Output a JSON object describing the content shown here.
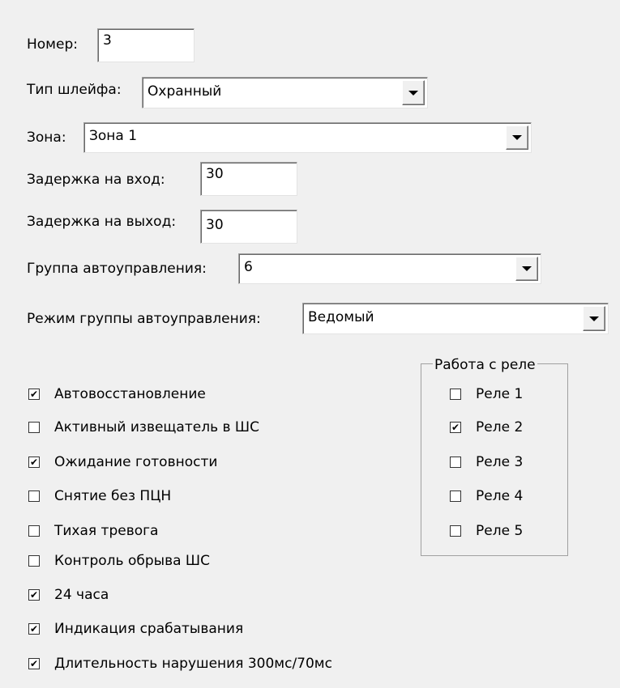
{
  "fields": {
    "number": {
      "label": "Номер:",
      "value": "3"
    },
    "loop_type": {
      "label": "Тип шлейфа:",
      "value": "Охранный"
    },
    "zone": {
      "label": "Зона:",
      "value": "Зона 1"
    },
    "entry_delay": {
      "label": "Задержка на вход:",
      "value": "30"
    },
    "exit_delay": {
      "label": "Задержка на выход:",
      "value": "30"
    },
    "auto_group": {
      "label": "Группа автоуправления:",
      "value": "6"
    },
    "auto_group_mode": {
      "label": "Режим группы автоуправления:",
      "value": "Ведомый"
    }
  },
  "options": [
    {
      "label": "Автовосстановление",
      "checked": true
    },
    {
      "label": "Активный извещатель в ШС",
      "checked": false
    },
    {
      "label": "Ожидание готовности",
      "checked": true
    },
    {
      "label": "Снятие без ПЦН",
      "checked": false
    },
    {
      "label": "Тихая тревога",
      "checked": false
    },
    {
      "label": "Контроль обрыва ШС",
      "checked": false
    },
    {
      "label": "24 часа",
      "checked": true
    },
    {
      "label": "Индикация срабатывания",
      "checked": true
    },
    {
      "label": "Длительность нарушения 300мс/70мс",
      "checked": true
    }
  ],
  "relay_group": {
    "title": "Работа с реле",
    "items": [
      {
        "label": "Реле 1",
        "checked": false
      },
      {
        "label": "Реле 2",
        "checked": true
      },
      {
        "label": "Реле 3",
        "checked": false
      },
      {
        "label": "Реле 4",
        "checked": false
      },
      {
        "label": "Реле 5",
        "checked": false
      }
    ]
  },
  "icons": {
    "dropdown": "chevron-down-icon",
    "check": "checkmark-icon"
  }
}
